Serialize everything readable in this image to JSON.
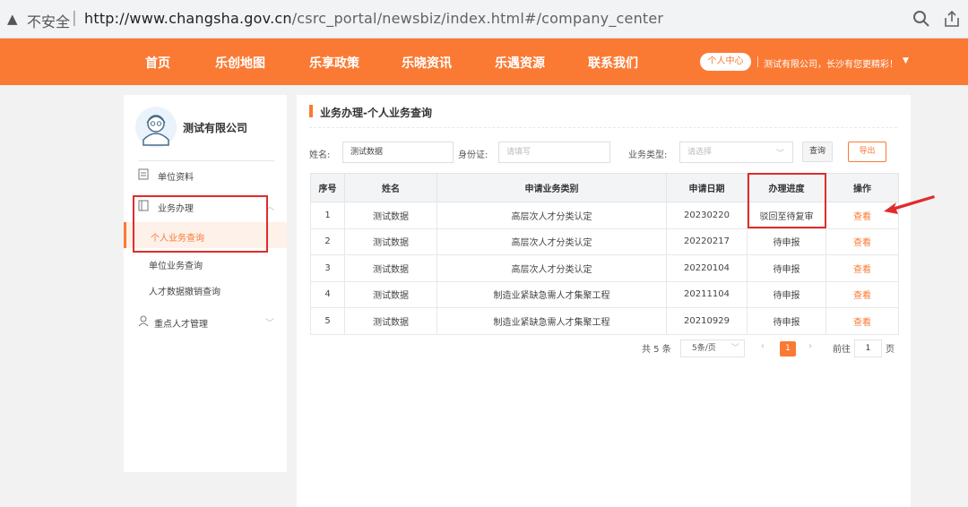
{
  "browser": {
    "insecure_label": "不安全",
    "url_host": "http://www.changsha.gov.cn",
    "url_path": "/csrc_portal/newsbiz/index.html#/company_center"
  },
  "nav": {
    "items": [
      "首页",
      "乐创地图",
      "乐享政策",
      "乐晓资讯",
      "乐遇资源",
      "联系我们"
    ],
    "user_center": "个人中心",
    "greeting": "测试有限公司，长沙有您更精彩！"
  },
  "sidebar": {
    "company": "测试有限公司",
    "items": {
      "unit_info": "单位资料",
      "business": "业务办理",
      "personal_query": "个人业务查询",
      "unit_query": "单位业务查询",
      "talent_revoke": "人才数据撤销查询",
      "key_talent": "重点人才管理"
    }
  },
  "main": {
    "title": "业务办理-个人业务查询",
    "form": {
      "name_label": "姓名:",
      "name_value": "测试数据",
      "id_label": "身份证:",
      "id_placeholder": "请填写",
      "type_label": "业务类型:",
      "type_placeholder": "请选择",
      "query_btn": "查询",
      "export_btn": "导出"
    },
    "table": {
      "headers": [
        "序号",
        "姓名",
        "申请业务类别",
        "申请日期",
        "办理进度",
        "操作"
      ],
      "rows": [
        [
          "1",
          "测试数据",
          "高层次人才分类认定",
          "20230220",
          "驳回至待复审",
          "查看"
        ],
        [
          "2",
          "测试数据",
          "高层次人才分类认定",
          "20220217",
          "待申报",
          "查看"
        ],
        [
          "3",
          "测试数据",
          "高层次人才分类认定",
          "20220104",
          "待申报",
          "查看"
        ],
        [
          "4",
          "测试数据",
          "制造业紧缺急需人才集聚工程",
          "20211104",
          "待申报",
          "查看"
        ],
        [
          "5",
          "测试数据",
          "制造业紧缺急需人才集聚工程",
          "20210929",
          "待申报",
          "查看"
        ]
      ]
    },
    "pager": {
      "total": "共 5 条",
      "page_size": "5条/页",
      "current": "1",
      "goto_label": "前往",
      "goto_value": "1",
      "page_unit": "页"
    }
  },
  "colors": {
    "accent": "#fa7a34",
    "highlight": "#e02c2c"
  }
}
